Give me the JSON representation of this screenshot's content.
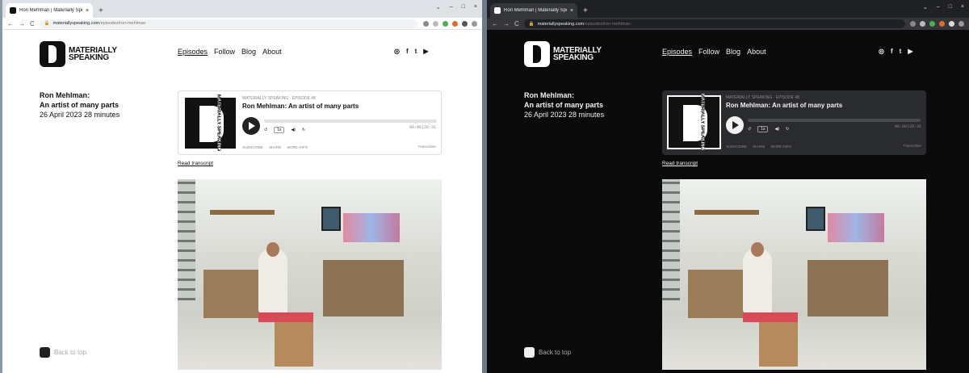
{
  "browser": {
    "tab_title": "Ron Mehlman | Materially Speaki...",
    "tab_close": "×",
    "new_tab": "+",
    "window_controls": [
      "⌄",
      "–",
      "□",
      "×"
    ],
    "url_host": "materiallyspeaking.com",
    "url_path": "/episodes/ron-mehlman",
    "nav_back": "←",
    "nav_forward": "→",
    "reload": "C"
  },
  "site": {
    "logo_line1": "MATERIALLY",
    "logo_line2": "SPEAKING",
    "nav": [
      "Episodes",
      "Follow",
      "Blog",
      "About"
    ],
    "social": [
      "◎",
      "f",
      "t",
      "▶"
    ]
  },
  "episode": {
    "name": "Ron Mehlman:",
    "subtitle": "An artist of many parts",
    "date_duration": "26 April 2023 28 minutes"
  },
  "player": {
    "art_label": "MATERIALLY SPEAKING",
    "series": "MATERIALLY SPEAKING · EPISODE 48",
    "title": "Ron Mehlman: An artist of many parts",
    "speed": "1x",
    "rewind": "↺",
    "forward": "↻",
    "volume": "◀)",
    "time": "00:00|28:31",
    "links": [
      "SUBSCRIBE",
      "SHARE",
      "MORE INFO"
    ],
    "transcriber": "Transcriber"
  },
  "read_transcript": "Read transcript",
  "back_to_top": "Back to top"
}
